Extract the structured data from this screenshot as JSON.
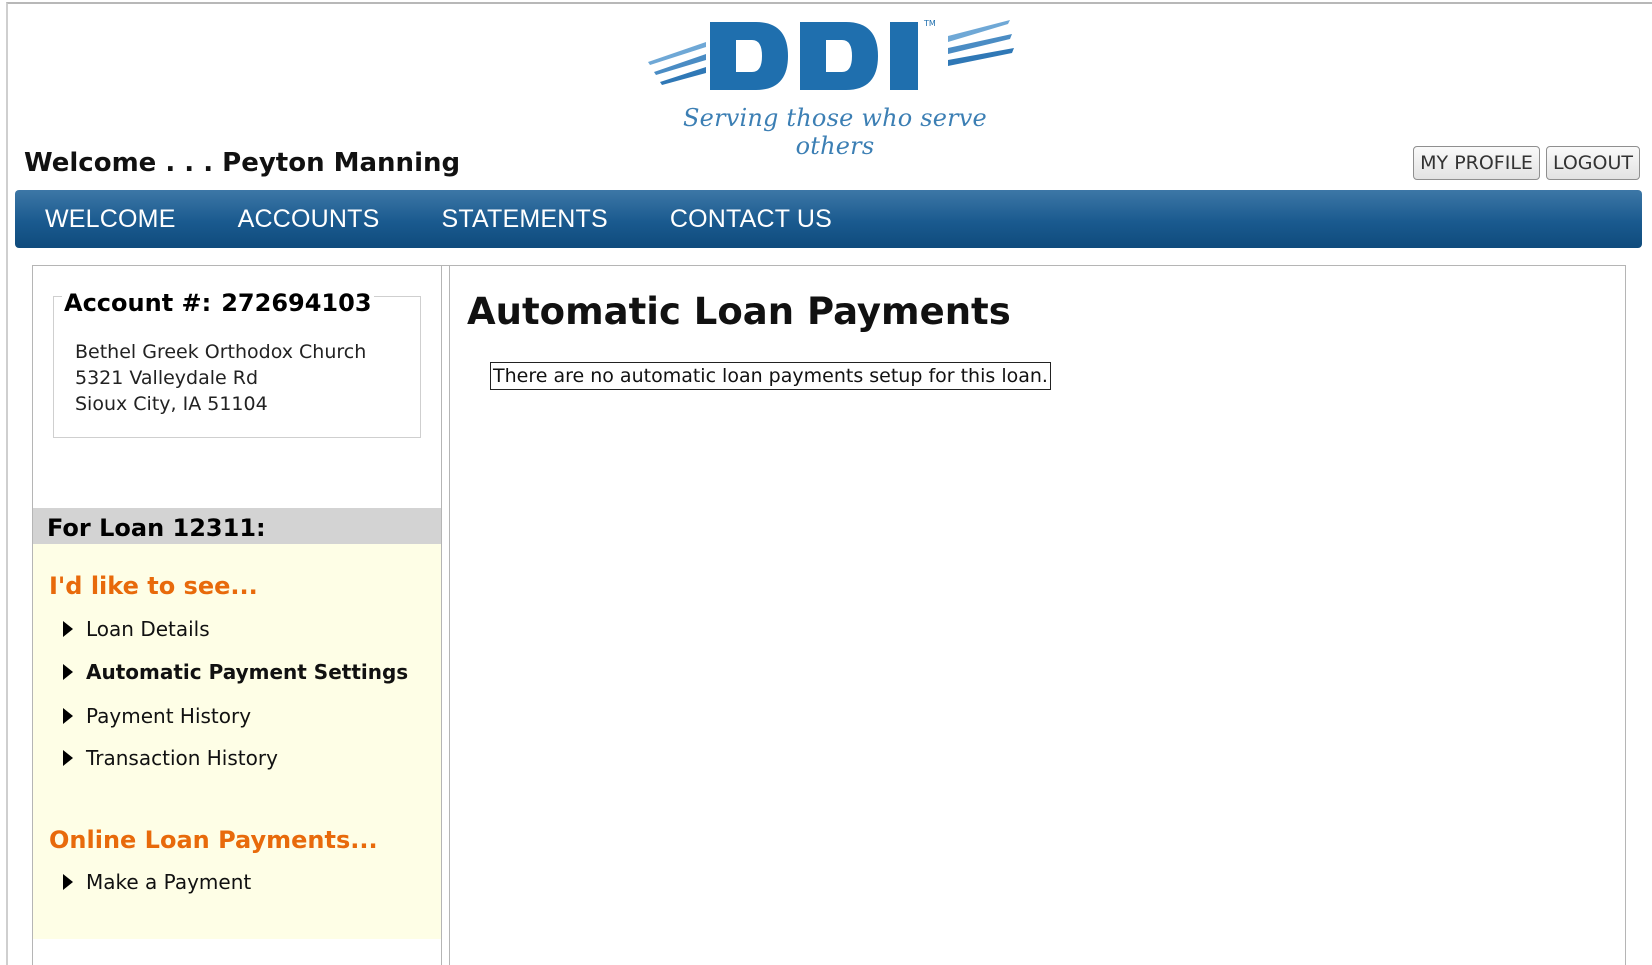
{
  "header": {
    "logo_text": "DDI",
    "tagline": "Serving those who serve others",
    "welcome": "Welcome . . . Peyton Manning",
    "buttons": {
      "profile": "MY PROFILE",
      "logout": "LOGOUT"
    }
  },
  "nav": {
    "items": [
      "WELCOME",
      "ACCOUNTS",
      "STATEMENTS",
      "CONTACT US"
    ]
  },
  "account": {
    "label": "Account #:",
    "number": "272694103",
    "address": [
      "Bethel Greek Orthodox Church",
      "5321 Valleydale Rd",
      "Sioux City, IA 51104"
    ]
  },
  "sidebar": {
    "loan_header": "For Loan 12311:",
    "see_heading": "I'd like to see...",
    "see_links": [
      "Loan Details",
      "Automatic Payment Settings",
      "Payment History",
      "Transaction History"
    ],
    "payments_heading": "Online Loan Payments...",
    "payments_links": [
      "Make a Payment"
    ]
  },
  "main": {
    "title": "Automatic Loan Payments",
    "notice": "There are no automatic loan payments setup for this loan."
  },
  "colors": {
    "nav_blue": "#1a5a8f",
    "logo_blue": "#1f6fae",
    "menu_orange": "#e86a0b",
    "menu_bg": "#fefee6"
  }
}
